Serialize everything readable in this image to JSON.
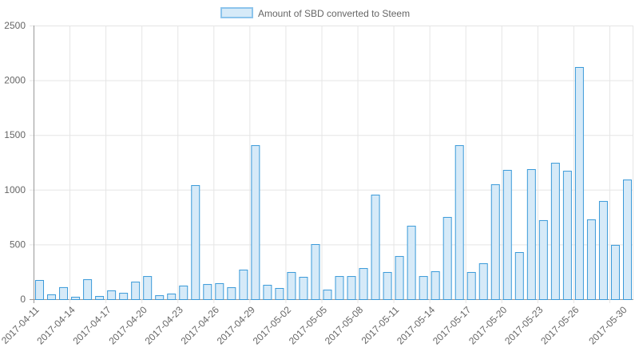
{
  "chart_data": {
    "type": "bar",
    "title": "",
    "legend": {
      "label": "Amount of SBD converted to Steem",
      "position": "top"
    },
    "xlabel": "",
    "ylabel": "",
    "ylim": [
      0,
      2500
    ],
    "yticks": [
      0,
      500,
      1000,
      1500,
      2000,
      2500
    ],
    "grid": true,
    "categories": [
      "2017-04-11",
      "2017-04-12",
      "2017-04-13",
      "2017-04-14",
      "2017-04-15",
      "2017-04-16",
      "2017-04-17",
      "2017-04-18",
      "2017-04-19",
      "2017-04-20",
      "2017-04-21",
      "2017-04-22",
      "2017-04-23",
      "2017-04-24",
      "2017-04-25",
      "2017-04-26",
      "2017-04-27",
      "2017-04-28",
      "2017-04-29",
      "2017-04-30",
      "2017-05-01",
      "2017-05-02",
      "2017-05-03",
      "2017-05-04",
      "2017-05-05",
      "2017-05-06",
      "2017-05-07",
      "2017-05-08",
      "2017-05-09",
      "2017-05-10",
      "2017-05-11",
      "2017-05-12",
      "2017-05-13",
      "2017-05-14",
      "2017-05-15",
      "2017-05-16",
      "2017-05-17",
      "2017-05-18",
      "2017-05-19",
      "2017-05-20",
      "2017-05-21",
      "2017-05-22",
      "2017-05-23",
      "2017-05-24",
      "2017-05-25",
      "2017-05-26",
      "2017-05-27",
      "2017-05-28",
      "2017-05-29",
      "2017-05-30"
    ],
    "shown_tick_labels": [
      "2017-04-11",
      "2017-04-14",
      "2017-04-17",
      "2017-04-20",
      "2017-04-23",
      "2017-04-26",
      "2017-04-29",
      "2017-05-02",
      "2017-05-05",
      "2017-05-08",
      "2017-05-11",
      "2017-05-14",
      "2017-05-17",
      "2017-05-20",
      "2017-05-23",
      "2017-05-26",
      "2017-05-30"
    ],
    "series": [
      {
        "name": "Amount of SBD converted to Steem",
        "values": [
          175,
          44,
          110,
          22,
          182,
          29,
          80,
          58,
          160,
          211,
          36,
          51,
          124,
          1042,
          138,
          146,
          109,
          270,
          1407,
          131,
          102,
          248,
          204,
          503,
          87,
          211,
          211,
          284,
          955,
          248,
          394,
          671,
          211,
          255,
          751,
          1407,
          248,
          328,
          1050,
          1181,
          430,
          1188,
          722,
          1246,
          1173,
          2121,
          729,
          897,
          496,
          1093
        ]
      }
    ],
    "colors": {
      "fill": "#d6eaf8",
      "stroke": "#3a9ad9",
      "legend_fill": "#d6eaf8",
      "legend_stroke": "#8cc4ec",
      "grid": "#e5e5e5",
      "axis": "#999999"
    }
  }
}
